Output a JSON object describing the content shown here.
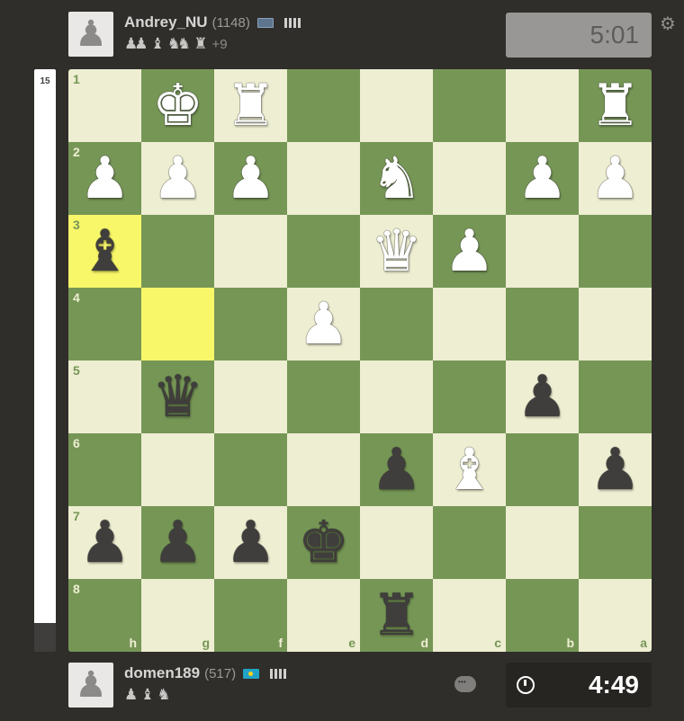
{
  "top_player": {
    "name": "Andrey_NU",
    "rating": "(1148)",
    "avatar_glyph": "♟",
    "flag": "computer",
    "captured_groups": [
      "♟♟",
      "♝",
      "♞♞",
      "♜"
    ],
    "material_advantage": "+9",
    "clock": "5:01"
  },
  "bottom_player": {
    "name": "domen189",
    "rating": "(517)",
    "avatar_glyph": "♟",
    "flag": "kz",
    "captured_groups": [
      "♟",
      "♝",
      "♞"
    ],
    "clock": "4:49"
  },
  "eval": {
    "label": "15",
    "white_fraction": 0.95
  },
  "board": {
    "light_color": "#eeeed2",
    "dark_color": "#769656",
    "rank_labels": [
      "1",
      "2",
      "3",
      "4",
      "5",
      "6",
      "7",
      "8"
    ],
    "file_labels": [
      "h",
      "g",
      "f",
      "e",
      "d",
      "c",
      "b",
      "a"
    ],
    "highlighted": [
      "h3",
      "g4"
    ],
    "pieces": {
      "g1": "wK",
      "f1": "wR",
      "a1": "wR",
      "h2": "wP",
      "g2": "wP",
      "f2": "wP",
      "d2": "wN",
      "b2": "wP",
      "a2": "wP",
      "h3": "bB",
      "d3": "wQ",
      "c3": "wP",
      "e4": "wP",
      "g5": "bQ",
      "b5": "bP",
      "d6": "bP",
      "c6": "wB",
      "a6": "bP",
      "h7": "bP",
      "g7": "bP",
      "f7": "bP",
      "e7": "bK",
      "d8": "bR"
    }
  }
}
